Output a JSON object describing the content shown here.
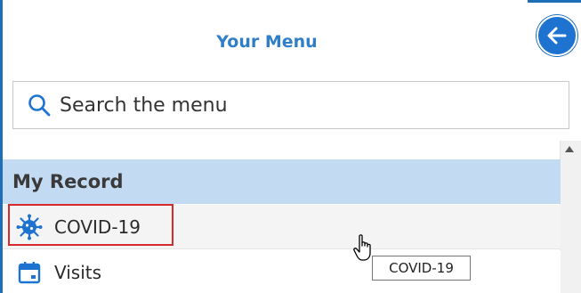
{
  "menu": {
    "title": "Your Menu",
    "back_icon": "arrow-left-icon"
  },
  "search": {
    "placeholder": "Search the menu",
    "icon": "search-icon"
  },
  "section": {
    "label": "My Record"
  },
  "items": [
    {
      "label": "COVID-19",
      "icon": "virus-icon",
      "highlighted": true
    },
    {
      "label": "Visits",
      "icon": "calendar-icon"
    }
  ],
  "tooltip": {
    "text": "COVID-19"
  },
  "colors": {
    "accent": "#1f73d0",
    "title": "#2f7fc8",
    "section_bg": "#c3dbf2",
    "highlight": "#d62b2b"
  }
}
